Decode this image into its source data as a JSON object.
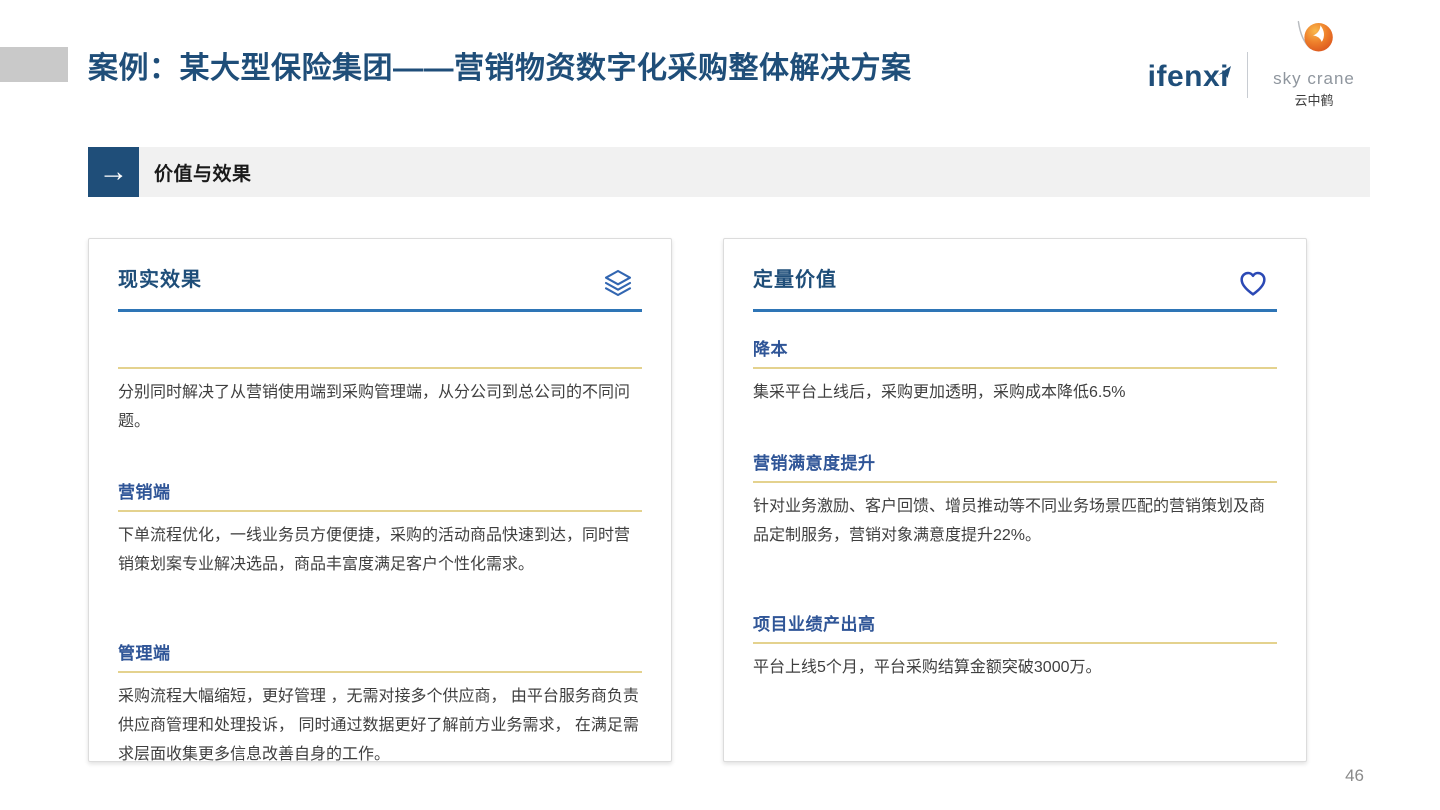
{
  "header": {
    "title": "案例：某大型保险集团——营销物资数字化采购整体解决方案",
    "logo_ifenxi": "ifenxi",
    "logo_skycrane_en": "sky crane",
    "logo_skycrane_cn": "云中鹤"
  },
  "section_bar": {
    "label": "价值与效果",
    "arrow_glyph": "→"
  },
  "cards": [
    {
      "title": "现实效果",
      "icon": "layers-icon",
      "sections": [
        {
          "heading": "",
          "text": "分别同时解决了从营销使用端到采购管理端，从分公司到总公司的不同问题。"
        },
        {
          "heading": "营销端",
          "text": "下单流程优化，一线业务员方便便捷，采购的活动商品快速到达，同时营销策划案专业解决选品，商品丰富度满足客户个性化需求。"
        },
        {
          "heading": "管理端",
          "text": "采购流程大幅缩短，更好管理 ，无需对接多个供应商， 由平台服务商负责供应商管理和处理投诉， 同时通过数据更好了解前方业务需求， 在满足需求层面收集更多信息改善自身的工作。"
        }
      ]
    },
    {
      "title": "定量价值",
      "icon": "heart-icon",
      "sections": [
        {
          "heading": "降本",
          "text": "集采平台上线后，采购更加透明，采购成本降低6.5%"
        },
        {
          "heading": "营销满意度提升",
          "text": "针对业务激励、客户回馈、增员推动等不同业务场景匹配的营销策划及商品定制服务，营销对象满意度提升22%。"
        },
        {
          "heading": "项目业绩产出高",
          "text": "平台上线5个月，平台采购结算金额突破3000万。"
        }
      ]
    }
  ],
  "footer": {
    "page_number": "46"
  },
  "colors": {
    "title_navy": "#1f4e79",
    "heading_blue": "#2f5597",
    "underline_blue": "#2e75b6",
    "gold_line": "#e4d28e",
    "body_text": "#3f3f3f",
    "bar_gray": "#f1f1f1"
  }
}
